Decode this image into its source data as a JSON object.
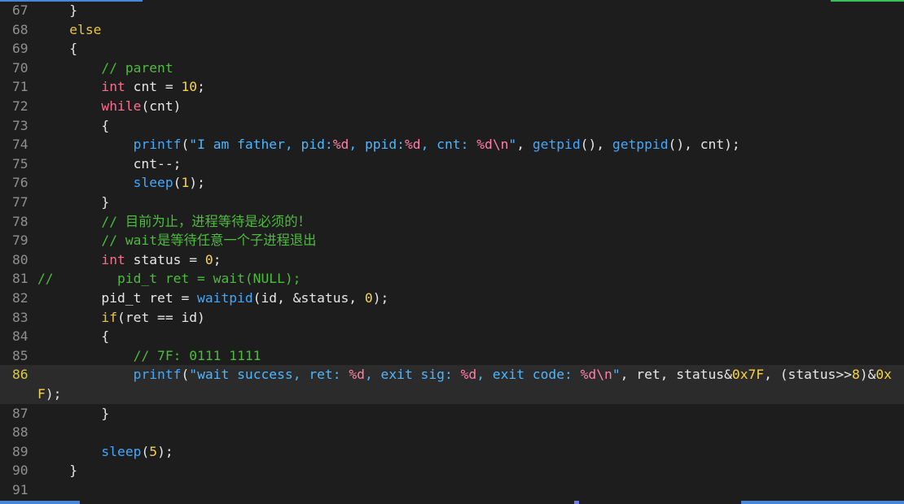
{
  "editor": {
    "current_line": "86",
    "lines": [
      {
        "num": "67",
        "tokens": [
          [
            "    }",
            "default"
          ]
        ]
      },
      {
        "num": "68",
        "tokens": [
          [
            "    ",
            "default"
          ],
          [
            "else",
            "ctrl"
          ]
        ]
      },
      {
        "num": "69",
        "tokens": [
          [
            "    {",
            "default"
          ]
        ]
      },
      {
        "num": "70",
        "tokens": [
          [
            "        ",
            "default"
          ],
          [
            "// parent",
            "comment"
          ]
        ]
      },
      {
        "num": "71",
        "tokens": [
          [
            "        ",
            "default"
          ],
          [
            "int",
            "kw"
          ],
          [
            " cnt = ",
            "default"
          ],
          [
            "10",
            "num"
          ],
          [
            ";",
            "default"
          ]
        ]
      },
      {
        "num": "72",
        "tokens": [
          [
            "        ",
            "default"
          ],
          [
            "while",
            "kw"
          ],
          [
            "(cnt)",
            "default"
          ]
        ]
      },
      {
        "num": "73",
        "tokens": [
          [
            "        {",
            "default"
          ]
        ]
      },
      {
        "num": "74",
        "tokens": [
          [
            "            ",
            "default"
          ],
          [
            "printf",
            "fn"
          ],
          [
            "(",
            "default"
          ],
          [
            "\"I am father, pid:",
            "str"
          ],
          [
            "%d",
            "fmt"
          ],
          [
            ", ppid:",
            "str"
          ],
          [
            "%d",
            "fmt"
          ],
          [
            ", cnt: ",
            "str"
          ],
          [
            "%d",
            "fmt"
          ],
          [
            "\\n",
            "fmt"
          ],
          [
            "\"",
            "str"
          ],
          [
            ", ",
            "default"
          ],
          [
            "getpid",
            "fn"
          ],
          [
            "(), ",
            "default"
          ],
          [
            "getppid",
            "fn"
          ],
          [
            "(), cnt);",
            "default"
          ]
        ]
      },
      {
        "num": "75",
        "tokens": [
          [
            "            cnt--;",
            "default"
          ]
        ]
      },
      {
        "num": "76",
        "tokens": [
          [
            "            ",
            "default"
          ],
          [
            "sleep",
            "fn"
          ],
          [
            "(",
            "default"
          ],
          [
            "1",
            "num"
          ],
          [
            ");",
            "default"
          ]
        ]
      },
      {
        "num": "77",
        "tokens": [
          [
            "        }",
            "default"
          ]
        ]
      },
      {
        "num": "78",
        "tokens": [
          [
            "        ",
            "default"
          ],
          [
            "// 目前为止，进程等待是必须的！",
            "comment"
          ]
        ]
      },
      {
        "num": "79",
        "tokens": [
          [
            "        ",
            "default"
          ],
          [
            "// wait是等待任意一个子进程退出",
            "comment"
          ]
        ]
      },
      {
        "num": "80",
        "tokens": [
          [
            "        ",
            "default"
          ],
          [
            "int",
            "kw"
          ],
          [
            " status = ",
            "default"
          ],
          [
            "0",
            "num"
          ],
          [
            ";",
            "default"
          ]
        ]
      },
      {
        "num": "81",
        "tokens": [
          [
            "//        pid_t ret = wait(NULL);",
            "comment"
          ]
        ]
      },
      {
        "num": "82",
        "tokens": [
          [
            "        pid_t ret = ",
            "default"
          ],
          [
            "waitpid",
            "fn"
          ],
          [
            "(id, &status, ",
            "default"
          ],
          [
            "0",
            "num"
          ],
          [
            ");",
            "default"
          ]
        ]
      },
      {
        "num": "83",
        "tokens": [
          [
            "        ",
            "default"
          ],
          [
            "if",
            "ctrl"
          ],
          [
            "(ret == id)",
            "default"
          ]
        ]
      },
      {
        "num": "84",
        "tokens": [
          [
            "        {",
            "default"
          ]
        ]
      },
      {
        "num": "85",
        "tokens": [
          [
            "            ",
            "default"
          ],
          [
            "// 7F: 0111 1111",
            "comment"
          ]
        ]
      },
      {
        "num": "86",
        "tokens": [
          [
            "            ",
            "default"
          ],
          [
            "printf",
            "fn"
          ],
          [
            "(",
            "default"
          ],
          [
            "\"wait success, ret: ",
            "str"
          ],
          [
            "%d",
            "fmt"
          ],
          [
            ", exit sig: ",
            "str"
          ],
          [
            "%d",
            "fmt"
          ],
          [
            ", exit code: ",
            "str"
          ],
          [
            "%d",
            "fmt"
          ],
          [
            "\\n",
            "fmt"
          ],
          [
            "\"",
            "str"
          ],
          [
            ", ret, status&",
            "default"
          ],
          [
            "0x7F",
            "num"
          ],
          [
            ", (status>>",
            "default"
          ],
          [
            "8",
            "num"
          ],
          [
            ")&",
            "default"
          ],
          [
            "0x",
            "num"
          ]
        ]
      },
      {
        "num": "",
        "wrap": true,
        "tokens": [
          [
            "F",
            "num"
          ],
          [
            ");",
            "default"
          ]
        ]
      },
      {
        "num": "87",
        "tokens": [
          [
            "        }",
            "default"
          ]
        ]
      },
      {
        "num": "88",
        "tokens": [
          [
            "",
            "default"
          ]
        ]
      },
      {
        "num": "89",
        "tokens": [
          [
            "        ",
            "default"
          ],
          [
            "sleep",
            "fn"
          ],
          [
            "(",
            "default"
          ],
          [
            "5",
            "num"
          ],
          [
            ");",
            "default"
          ]
        ]
      },
      {
        "num": "90",
        "tokens": [
          [
            "    }",
            "default"
          ]
        ]
      },
      {
        "num": "91",
        "tokens": [
          [
            "",
            "default"
          ]
        ]
      }
    ]
  }
}
